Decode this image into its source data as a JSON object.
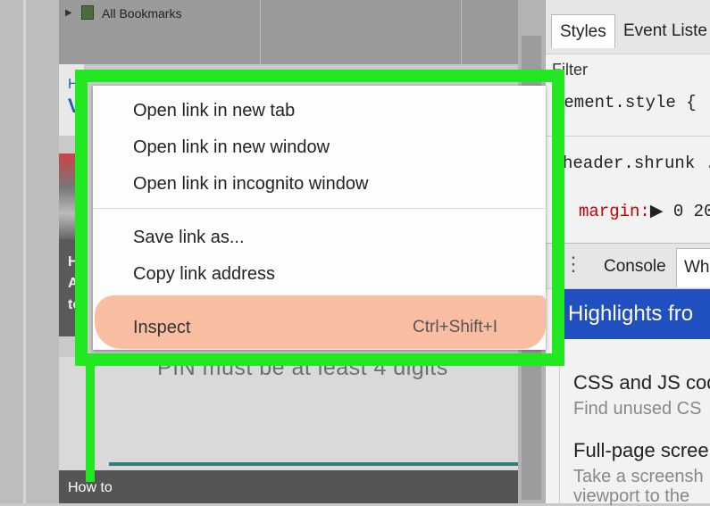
{
  "bookmarks": {
    "label": "All Bookmarks"
  },
  "page": {
    "link_heading_short": "H",
    "link_heading_big": "V",
    "thumb_text_lines": [
      "H",
      "A",
      "to"
    ],
    "pin_text": "PIN must be at least 4 digits",
    "howto_label": "How to"
  },
  "context_menu": {
    "items": [
      {
        "label": "Open link in new tab"
      },
      {
        "label": "Open link in new window"
      },
      {
        "label": "Open link in incognito window"
      },
      {
        "label": "Save link as..."
      },
      {
        "label": "Copy link address"
      }
    ],
    "inspect": {
      "label": "Inspect",
      "shortcut": "Ctrl+Shift+I"
    }
  },
  "devtools": {
    "tabs": {
      "styles": "Styles",
      "events": "Event Liste"
    },
    "filter_label": "Filter",
    "code": {
      "element_style": "lement.style {",
      "selector": "header.shrunk .",
      "property": "margin:",
      "arrow": "▶",
      "value": "0 20"
    },
    "drawer_tabs": {
      "console": "Console",
      "whats_new": "Wh"
    },
    "highlights_title": "Highlights fro",
    "features": [
      {
        "title": "CSS and JS cod",
        "desc": "Find unused CS"
      },
      {
        "title": "Full-page scree",
        "desc": "Take a screensh",
        "desc2": "viewport to the"
      }
    ]
  },
  "colors": {
    "highlight_frame": "#22e822",
    "inspect_highlight": "#f9b89a",
    "highlights_banner": "#2050c0",
    "css_property": "#c80000"
  }
}
